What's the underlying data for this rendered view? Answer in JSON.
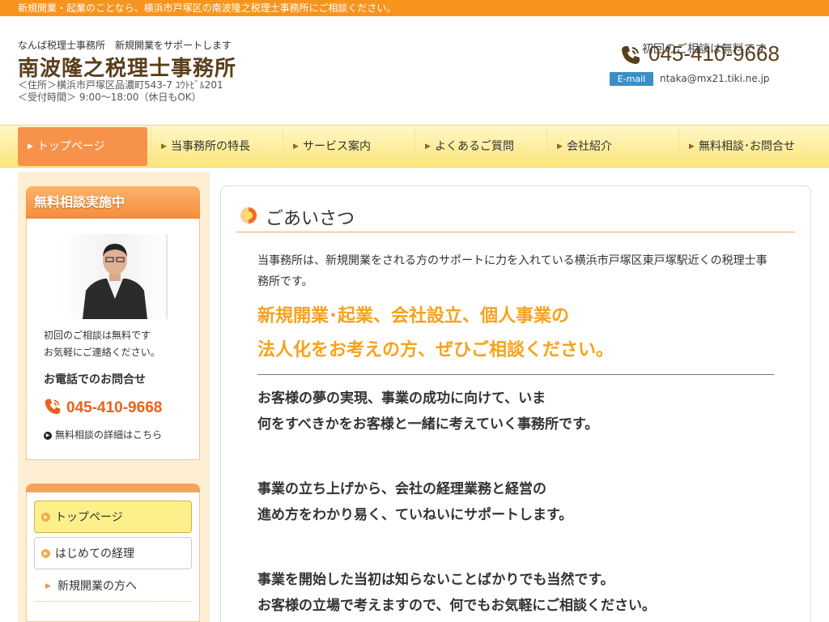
{
  "topbar": {
    "text": "新規開業・起業のことなら、横浜市戸塚区の南波隆之税理士事務所にご相談ください。"
  },
  "header": {
    "tagline": "なんば税理士事務所　新規開業をサポートします",
    "title": "南波隆之税理士事務所",
    "address": "＜住所＞横浜市戸塚区品濃町543-7 ﾕｳﾄﾋﾞﾙ201",
    "hours": "＜受付時間＞ 9:00〜18:00（休日もOK）",
    "contact_note": "初回のご相談は無料です",
    "phone": "045-410-9668",
    "email_label": "E-mail",
    "email": "ntaka@mx21.tiki.ne.jp"
  },
  "nav": {
    "items": [
      {
        "label": "トップページ"
      },
      {
        "label": "当事務所の特長"
      },
      {
        "label": "サービス案内"
      },
      {
        "label": "よくあるご質問"
      },
      {
        "label": "会社紹介"
      },
      {
        "label": "無料相談･お問合せ"
      }
    ]
  },
  "sidebar": {
    "consult_title": "無料相談実施中",
    "note_line1": "初回のご相談は無料です",
    "note_line2": "お気軽にご連絡ください。",
    "tel_heading": "お電話でのお問合せ",
    "phone": "045-410-9668",
    "detail_link": "無料相談の詳細はこちら",
    "menu": [
      {
        "label": "トップページ"
      },
      {
        "label": "はじめての経理"
      }
    ],
    "submenu": [
      {
        "label": "新規開業の方へ"
      }
    ]
  },
  "main": {
    "heading": "ごあいさつ",
    "intro": "当事務所は、新規開業をされる方のサポートに力を入れている横浜市戸塚区東戸塚駅近くの税理士事務所です。",
    "catch_line1": "新規開業･起業、会社設立、個人事業の",
    "catch_line2": "法人化をお考えの方、ぜひご相談ください。",
    "para1_line1": "お客様の夢の実現、事業の成功に向けて、いま",
    "para1_line2": "何をすべきかをお客様と一緒に考えていく事務所です。",
    "para2_line1": "事業の立ち上げから、会社の経理業務と経営の",
    "para2_line2": "進め方をわかり易く、ていねいにサポートします。",
    "para3_line1": "事業を開始した当初は知らないことばかりでも当然です。",
    "para3_line2": "お客様の立場で考えますので、何でもお気軽にご相談ください。"
  },
  "colors": {
    "accent_orange": "#f7941d",
    "title_brown": "#5a3e1b",
    "catch_orange": "#f7a21b",
    "nav_yellow": "#fce57a",
    "email_blue": "#3b8fc6"
  }
}
